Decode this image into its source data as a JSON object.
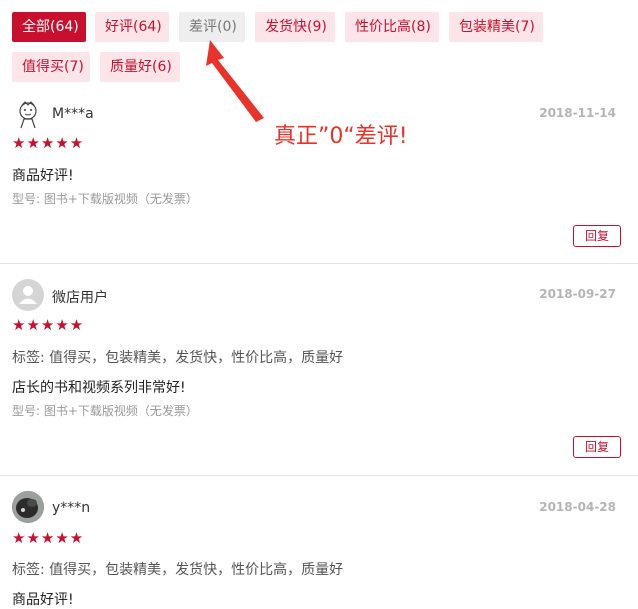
{
  "filters": [
    {
      "label": "全部(64)",
      "state": "active"
    },
    {
      "label": "好评(64)",
      "state": "normal"
    },
    {
      "label": "差评(0)",
      "state": "grey"
    },
    {
      "label": "发货快(9)",
      "state": "normal"
    },
    {
      "label": "性价比高(8)",
      "state": "normal"
    },
    {
      "label": "包装精美(7)",
      "state": "normal"
    },
    {
      "label": "值得买(7)",
      "state": "normal"
    },
    {
      "label": "质量好(6)",
      "state": "normal"
    }
  ],
  "annotation": {
    "text": "真正”0“差评!",
    "color": "#e8322a"
  },
  "reviews": [
    {
      "user": "M***a",
      "avatar_icon": "cartoon-face-avatar",
      "date": "2018-11-14",
      "rating": 5,
      "stars": "★★★★★",
      "tags": "",
      "content": "商品好评!",
      "model": "型号: 图书+下载版视频（无发票）",
      "reply_label": "回复"
    },
    {
      "user": "微店用户",
      "avatar_icon": "default-user-avatar",
      "date": "2018-09-27",
      "rating": 5,
      "stars": "★★★★★",
      "tags": "标签: 值得买，包装精美，发货快，性价比高，质量好",
      "content": "店长的书和视频系列非常好!",
      "model": "型号: 图书+下载版视频（无发票）",
      "reply_label": "回复"
    },
    {
      "user": "y***n",
      "avatar_icon": "photo-avatar",
      "date": "2018-04-28",
      "rating": 5,
      "stars": "★★★★★",
      "tags": "标签: 值得买，包装精美，发货快，性价比高，质量好",
      "content": "商品好评!"
    }
  ],
  "colors": {
    "accent": "#c8102e",
    "tag_bg": "#fbe5e8",
    "grey_tag_bg": "#eeeeee",
    "date": "#b5b5b5"
  }
}
